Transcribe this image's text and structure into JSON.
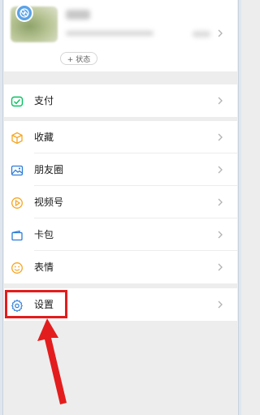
{
  "profile": {
    "status_label": "+ 状态"
  },
  "menu": {
    "payment": {
      "label": "支付",
      "icon": "wechat-pay-icon"
    },
    "favorites": {
      "label": "收藏",
      "icon": "favorites-cube-icon"
    },
    "moments": {
      "label": "朋友圈",
      "icon": "moments-photo-icon"
    },
    "channels": {
      "label": "视频号",
      "icon": "channels-play-icon"
    },
    "cards": {
      "label": "卡包",
      "icon": "card-wallet-icon"
    },
    "stickers": {
      "label": "表情",
      "icon": "sticker-smile-icon"
    },
    "settings": {
      "label": "设置",
      "icon": "gear-icon"
    }
  },
  "colors": {
    "accent_green": "#07c160",
    "annotation_red": "#e31d1d",
    "icon_blue": "#2c7cd8",
    "icon_orange": "#f5a623"
  }
}
